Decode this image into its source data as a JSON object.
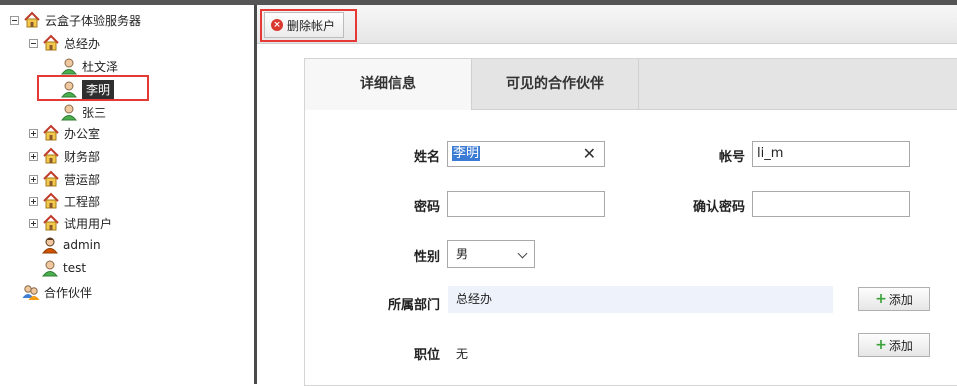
{
  "tree": {
    "root": {
      "label": "云盒子体验服务器",
      "icon": "server-home-icon"
    },
    "groups": [
      {
        "label": "总经办",
        "icon": "department-house-icon",
        "expanded": true,
        "children": [
          {
            "label": "杜文泽",
            "icon": "user-icon"
          },
          {
            "label": "李明",
            "icon": "user-icon",
            "selected": true
          },
          {
            "label": "张三",
            "icon": "user-icon"
          }
        ]
      },
      {
        "label": "办公室",
        "icon": "department-house-icon"
      },
      {
        "label": "财务部",
        "icon": "department-house-icon"
      },
      {
        "label": "营运部",
        "icon": "department-house-icon"
      },
      {
        "label": "工程部",
        "icon": "department-house-icon"
      },
      {
        "label": "试用用户",
        "icon": "department-house-icon"
      }
    ],
    "users": [
      {
        "label": "admin",
        "icon": "admin-user-icon"
      },
      {
        "label": "test",
        "icon": "user-icon"
      }
    ],
    "partners": {
      "label": "合作伙伴",
      "icon": "partners-icon"
    }
  },
  "toolbar": {
    "delete_label": "删除帐户"
  },
  "tabs": [
    {
      "label": "详细信息",
      "active": true
    },
    {
      "label": "可见的合作伙伴",
      "active": false
    }
  ],
  "form": {
    "name_label": "姓名",
    "name_value": "李明",
    "account_label": "帐号",
    "account_value": "li_m",
    "password_label": "密码",
    "password_value": "",
    "confirm_label": "确认密码",
    "confirm_value": "",
    "gender_label": "性别",
    "gender_value": "男",
    "dept_label": "所属部门",
    "dept_value": "总经办",
    "position_label": "职位",
    "position_value": "无",
    "add_label": "添加"
  },
  "colors": {
    "highlight_box": "#e53935",
    "selection": "#2f2f2f",
    "accent_plus": "#3aa23a"
  }
}
